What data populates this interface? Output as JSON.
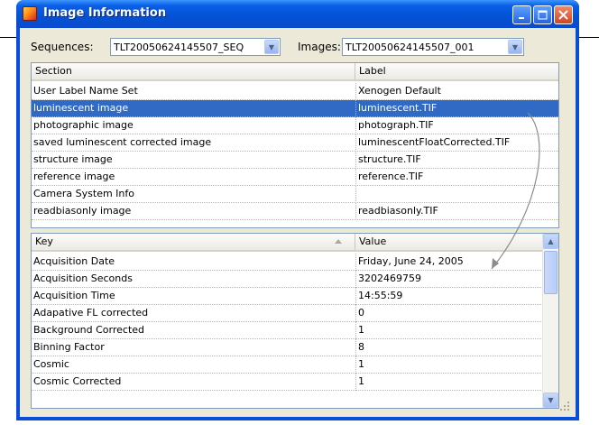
{
  "window": {
    "title": "Image Information"
  },
  "toolbar": {
    "sequences_label": "Sequences:",
    "sequences_value": "TLT20050624145507_SEQ",
    "images_label": "Images:",
    "images_value": "TLT20050624145507_001"
  },
  "section_table": {
    "headers": {
      "section": "Section",
      "label": "Label"
    },
    "rows": [
      {
        "section": "User Label Name Set",
        "label": "Xenogen Default"
      },
      {
        "section": "luminescent image",
        "label": "luminescent.TIF"
      },
      {
        "section": "photographic image",
        "label": "photograph.TIF"
      },
      {
        "section": "saved luminescent corrected image",
        "label": "luminescentFloatCorrected.TIF"
      },
      {
        "section": "structure image",
        "label": "structure.TIF"
      },
      {
        "section": "reference image",
        "label": "reference.TIF"
      },
      {
        "section": "Camera System Info",
        "label": ""
      },
      {
        "section": "readbiasonly image",
        "label": "readbiasonly.TIF"
      }
    ],
    "selected_row": "luminescent image"
  },
  "key_table": {
    "headers": {
      "key": "Key",
      "value": "Value"
    },
    "rows": [
      {
        "key": "Acquisition Date",
        "value": "Friday, June 24, 2005"
      },
      {
        "key": "Acquisition Seconds",
        "value": "3202469759"
      },
      {
        "key": "Acquisition Time",
        "value": "14:55:59"
      },
      {
        "key": "Adapative FL corrected",
        "value": "0"
      },
      {
        "key": "Background Corrected",
        "value": "1"
      },
      {
        "key": "Binning Factor",
        "value": "8"
      },
      {
        "key": "Cosmic",
        "value": "1"
      },
      {
        "key": "Cosmic Corrected",
        "value": "1"
      }
    ]
  },
  "colors": {
    "selection": "#316ac5",
    "titlebar": "#0a5fe6",
    "frame": "#0a4dd8",
    "arrow": "#8c8c8c"
  }
}
